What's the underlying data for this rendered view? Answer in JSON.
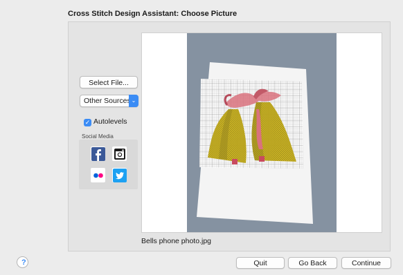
{
  "window": {
    "title": "Cross Stitch Design Assistant: Choose Picture"
  },
  "controls": {
    "select_file_label": "Select File...",
    "sources_popup_value": "Other Sources",
    "autolevels_label": "Autolevels",
    "autolevels_checked": true,
    "social_media_label": "Social Media",
    "social_icons": [
      "facebook-icon",
      "instagram-icon",
      "flickr-icon",
      "twitter-icon"
    ]
  },
  "preview": {
    "filename": "Bells phone photo.jpg"
  },
  "footer": {
    "help_label": "?",
    "quit_label": "Quit",
    "go_back_label": "Go Back",
    "continue_label": "Continue"
  },
  "colors": {
    "accent": "#3b8cf5",
    "facebook": "#3b5998",
    "twitter": "#1da1f2",
    "flickr_blue": "#0063dc",
    "flickr_pink": "#ff0084"
  }
}
